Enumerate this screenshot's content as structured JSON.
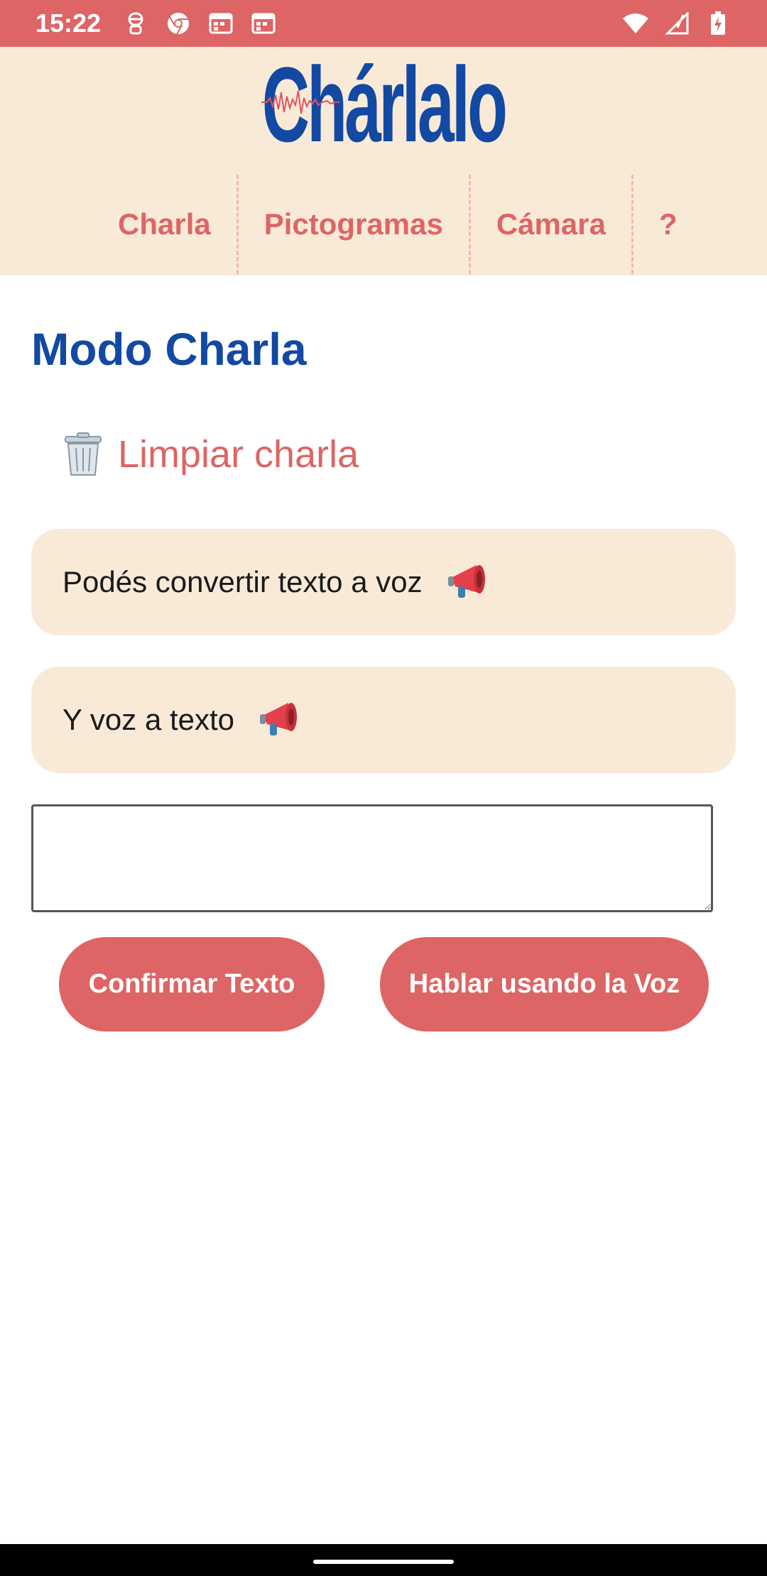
{
  "status_bar": {
    "time": "15:22",
    "left_icons": [
      "assistant-icon",
      "chrome-icon",
      "calendar-icon",
      "calendar-icon"
    ],
    "right_icons": [
      "wifi-icon",
      "signal-icon",
      "battery-charging-icon"
    ]
  },
  "header": {
    "logo": "Chárlalo",
    "nav": [
      {
        "label": "Charla"
      },
      {
        "label": "Pictogramas"
      },
      {
        "label": "Cámara"
      },
      {
        "label": "?"
      }
    ]
  },
  "main": {
    "title": "Modo Charla",
    "clear_label": "Limpiar charla",
    "messages": [
      {
        "text": "Podés convertir texto a voz"
      },
      {
        "text": "Y voz a texto"
      }
    ],
    "input_value": "",
    "confirm_label": "Confirmar Texto",
    "voice_label": "Hablar usando la Voz"
  },
  "colors": {
    "accent": "#dd6565",
    "brand": "#1249a3",
    "header_bg": "#f9ead8",
    "bubble_bg": "#f9ead8"
  }
}
